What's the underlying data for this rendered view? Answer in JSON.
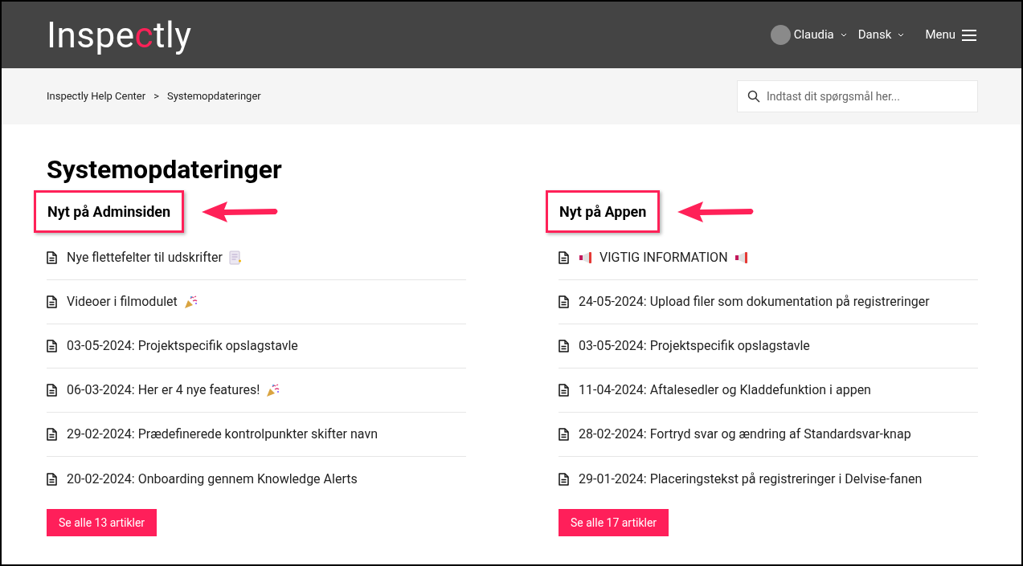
{
  "header": {
    "logo": {
      "parts": [
        {
          "text": "Inspe",
          "accent": false
        },
        {
          "text": "c",
          "accent": true
        },
        {
          "text": "tly",
          "accent": false
        }
      ]
    },
    "user": {
      "name": "Claudia"
    },
    "language": "Dansk",
    "menu": "Menu"
  },
  "breadcrumb": {
    "separator": ">",
    "items": [
      "Inspectly Help Center",
      "Systemopdateringer"
    ]
  },
  "search": {
    "placeholder": "Indtast dit spørgsmål her..."
  },
  "page_title": "Systemopdateringer",
  "sections": [
    {
      "title": "Nyt på Adminsiden",
      "highlighted": true,
      "articles": [
        {
          "title": "Nye flettefelter til udskrifter",
          "kind": "memo"
        },
        {
          "title": "Videoer i filmodulet",
          "kind": "party"
        },
        {
          "title": "03-05-2024: Projektspecifik opslagstavle",
          "kind": "plain"
        },
        {
          "title": "06-03-2024: Her er 4 nye features!",
          "kind": "party"
        },
        {
          "title": "29-02-2024: Prædefinerede kontrolpunkter skifter navn",
          "kind": "plain"
        },
        {
          "title": "20-02-2024: Onboarding gennem Knowledge Alerts",
          "kind": "plain"
        }
      ],
      "see_all": "Se alle 13 artikler"
    },
    {
      "title": "Nyt på Appen",
      "highlighted": true,
      "articles": [
        {
          "title": "VIGTIG INFORMATION",
          "kind": "announcement"
        },
        {
          "title": "24-05-2024: Upload filer som dokumentation på registreringer",
          "kind": "plain"
        },
        {
          "title": "03-05-2024: Projektspecifik opslagstavle",
          "kind": "plain"
        },
        {
          "title": "11-04-2024: Aftalesedler og Kladdefunktion i appen",
          "kind": "plain"
        },
        {
          "title": "28-02-2024: Fortryd svar og ændring af Standardsvar-knap",
          "kind": "plain"
        },
        {
          "title": "29-01-2024: Placeringstekst på registreringer i Delvise-fanen",
          "kind": "plain"
        }
      ],
      "see_all": "Se alle 17 artikler"
    }
  ]
}
